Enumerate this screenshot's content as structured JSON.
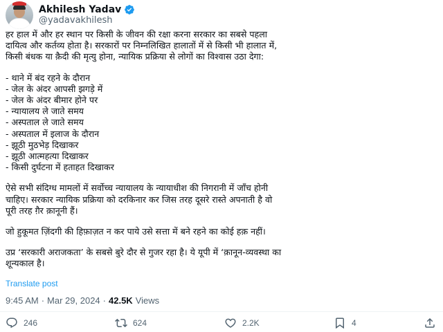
{
  "author": {
    "name": "Akhilesh Yadav",
    "handle": "@yadavakhilesh"
  },
  "post": {
    "intro": [
      "हर हाल में और हर स्थान पर किसी के जीवन की रक्षा करना सरकार का सबसे पहला",
      "दायित्व और कर्तव्य होता है। सरकारों पर निम्नलिखित हालातों में से किसी भी हालात में,",
      "किसी बंधक या क़ैदी की मृत्यु होना, न्यायिक प्रक्रिया से लोगों का विश्वास उठा देगा:"
    ],
    "items": [
      "- थाने में बंद रहने के दौरान",
      "- जेल के अंदर आपसी झगड़े में",
      "- जेल के अंदर बीमार होने पर",
      "- न्यायालय ले जाते समय",
      "- अस्पताल ले जाते समय",
      "- अस्पताल में इलाज के दौरान",
      "- झूठी मुठभेड़ दिखाकर",
      "- झूठी आत्महत्या दिखाकर",
      "- किसी दुर्घटना में हताहत दिखाकर"
    ],
    "para2": [
      "ऐसे सभी संदिग्ध मामलों में सर्वोच्च न्यायालय के न्यायाधीश की निगरानी में जाँच होनी",
      "चाहिए। सरकार न्यायिक प्रक्रिया को दरकिनार कर जिस तरह दूसरे रास्ते अपनाती है वो",
      "पूरी तरह ग़ैर क़ानूनी हैं।"
    ],
    "para3": "जो हुकूमत ज़िंदगी की हिफ़ाज़त न कर पाये उसे सत्ता में बने रहने का कोई हक़ नहीं।",
    "para4": [
      "उप्र ‘सरकारी अराजकता’ के सबसे बुरे दौर से गुजर रहा है। ये यूपी में ‘क़ानून-व्यवस्था का",
      "शून्यकाल है।"
    ]
  },
  "translate_label": "Translate post",
  "meta": {
    "time": "9:45 AM",
    "sep1": "·",
    "date": "Mar 29, 2024",
    "sep2": "·",
    "views_count": "42.5K",
    "views_label": "Views"
  },
  "actions": {
    "replies": "246",
    "reposts": "624",
    "likes": "2.2K",
    "bookmarks": "4"
  },
  "colors": {
    "accent": "#1d9bf0",
    "text": "#0f1419",
    "muted": "#536471"
  }
}
